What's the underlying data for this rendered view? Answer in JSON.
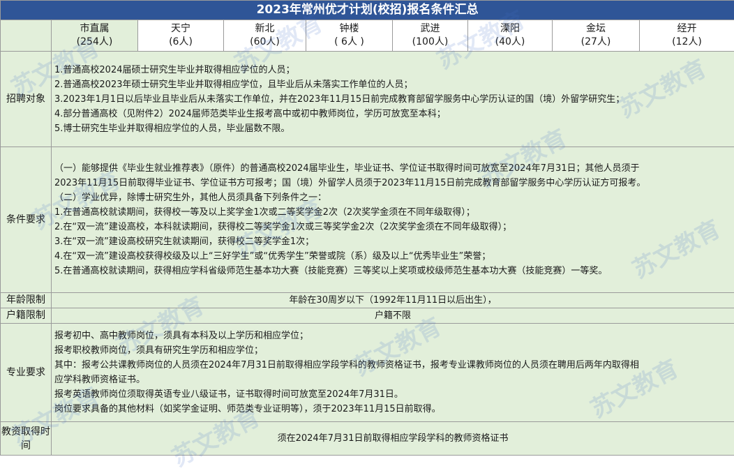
{
  "title": "2023年常州优才计划(校招)报名条件汇总",
  "regions": [
    {
      "name": "市直属",
      "count": "(254人)"
    },
    {
      "name": "天宁",
      "count": "(6人)"
    },
    {
      "name": "新北",
      "count": "(60人)"
    },
    {
      "name": "钟楼",
      "count": "( 6人 )"
    },
    {
      "name": "武进",
      "count": "(100人)"
    },
    {
      "name": "溧阳",
      "count": "(40人)"
    },
    {
      "name": "金坛",
      "count": "(27人)"
    },
    {
      "name": "经开",
      "count": "(12人)"
    }
  ],
  "rows": {
    "target": {
      "label": "招聘对象",
      "lines": [
        "1.普通高校2024届硕士研究生毕业并取得相应学位的人员；",
        "2.普通高校2023年硕士研究生毕业并取得相应学位，且毕业后从未落实工作单位的人员；",
        "3.2023年1月1日以后毕业且毕业后从未落实工作单位，并在2023年11月15日前完成教育部留学服务中心学历认证的国（境）外留学研究生；",
        "4.部分普通高校（见附件2）2024届师范类毕业生报考高中或初中教师岗位，学历可放宽至本科；",
        "5.博士研究生毕业并取得相应学位的人员，毕业届数不限。"
      ]
    },
    "conditions": {
      "label": "条件要求",
      "lines": [
        "（一）能够提供《毕业生就业推荐表》（原件）的普通高校2024届毕业生，毕业证书、学位证书取得时间可放宽至2024年7月31日；其他人员须于",
        "2023年11月15日前取得毕业证书、学位证书方可报考；国（境）外留学人员须于2023年11月15日前完成教育部留学服务中心学历认证方可报考。",
        "（二）学业优异，除博士研究生外，其他人员须具备下列条件之一：",
        "1.在普通高校就读期间，获得校一等及以上奖学金1次或二等奖学金2次（2次奖学金须在不同年级取得）；",
        "2.在“双一流”建设高校，本科就读期间，获得校二等奖学金1次或三等奖学金2次（2次奖学金须在不同年级取得）；",
        "3.在“双一流”建设高校研究生就读期间，获得校二等奖学金1次；",
        "4.在“双一流”建设高校获得校级及以上“三好学生”或“优秀学生”荣誉或院（系）级及以上“优秀毕业生”荣誉；",
        "5.在普通高校就读期间，获得相应学科省级师范生基本功大赛（技能竞赛）三等奖以上奖项或校级师范生基本功大赛（技能竞赛）一等奖。"
      ]
    },
    "age": {
      "label": "年龄限制",
      "text": "年龄在30周岁以下（1992年11月11日以后出生），"
    },
    "household": {
      "label": "户籍限制",
      "text": "户籍不限"
    },
    "major": {
      "label": "专业要求",
      "lines": [
        "报考初中、高中教师岗位，须具有本科及以上学历和相应学位；",
        "报考职校教师岗位，须具有研究生学历和相应学位；",
        "其中：报考公共课教师岗位的人员须在2024年7月31日前取得相应学段学科的教师资格证书，报考专业课教师岗位的人员须在聘用后两年内取得相",
        "应学科教师资格证书。",
        "报考英语教师岗位须取得英语专业八级证书，证书取得时间可放宽至2024年7月31日。",
        "岗位要求具备的其他材料（如奖学金证明、师范类专业证明等），须于2023年11月15日前取得。"
      ]
    },
    "cert": {
      "label": "教资取得时间",
      "text": "须在2024年7月31日前取得相应学段学科的教师资格证书"
    }
  },
  "watermark": "苏文教育"
}
